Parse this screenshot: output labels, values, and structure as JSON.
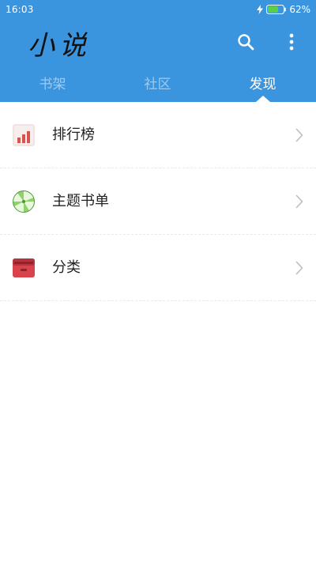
{
  "status_bar": {
    "time": "16:03",
    "battery_percent": "62%",
    "battery_level": 0.62,
    "charging": true
  },
  "header": {
    "title": "小说",
    "background_color": "#3a95de",
    "search_icon": "search-icon",
    "more_icon": "more-vertical-icon"
  },
  "tabs": [
    {
      "label": "书架",
      "active": false
    },
    {
      "label": "社区",
      "active": false
    },
    {
      "label": "发现",
      "active": true
    }
  ],
  "discover_list": [
    {
      "label": "排行榜",
      "icon": "ranking-chart-icon"
    },
    {
      "label": "主题书单",
      "icon": "swirl-candy-icon"
    },
    {
      "label": "分类",
      "icon": "category-box-icon"
    }
  ],
  "colors": {
    "accent": "#3a95de",
    "chevron": "#bdbdbd"
  }
}
